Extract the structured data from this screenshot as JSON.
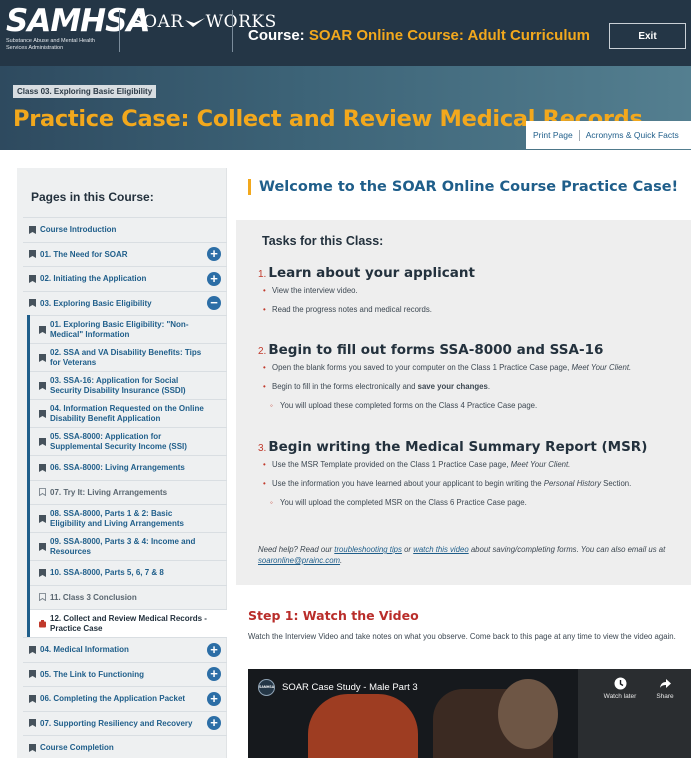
{
  "header": {
    "logo_text": "SAMHSA",
    "logo_sub": "Substance Abuse and Mental Health Services Administration",
    "soar_logo_left": "SOAR",
    "soar_logo_right": "WORKS",
    "course_prefix": "Course:",
    "course_name": "SOAR Online Course: Adult Curriculum",
    "exit_label": "Exit"
  },
  "title_band": {
    "class_tag": "Class 03. Exploring Basic Eligibility",
    "page_title": "Practice Case: Collect and Review Medical Records",
    "print_label": "Print Page",
    "acronyms_label": "Acronyms & Quick Facts"
  },
  "sidebar": {
    "title": "Pages in this Course:",
    "items": [
      {
        "label": "Course Introduction",
        "expand": false
      },
      {
        "label": "01. The Need for SOAR",
        "expand": "plus"
      },
      {
        "label": "02. Initiating the Application",
        "expand": "plus"
      },
      {
        "label": "03. Exploring Basic Eligibility",
        "expand": "minus"
      }
    ],
    "subitems": [
      {
        "label": "01. Exploring Basic Eligibility: \"Non-Medical\" Information",
        "state": "done"
      },
      {
        "label": "02. SSA and VA Disability Benefits: Tips for Veterans",
        "state": "done"
      },
      {
        "label": "03. SSA-16: Application for Social Security Disability Insurance (SSDI)",
        "state": "done"
      },
      {
        "label": "04. Information Requested on the Online Disability Benefit Application",
        "state": "done"
      },
      {
        "label": "05. SSA-8000: Application for Supplemental Security Income (SSI)",
        "state": "done"
      },
      {
        "label": "06. SSA-8000: Living Arrangements",
        "state": "done"
      },
      {
        "label": "07. Try It: Living Arrangements",
        "state": "open"
      },
      {
        "label": "08. SSA-8000, Parts 1 & 2: Basic Eligibility and Living Arrangements",
        "state": "done"
      },
      {
        "label": "09. SSA-8000, Parts 3 & 4: Income and Resources",
        "state": "done"
      },
      {
        "label": "10. SSA-8000, Parts 5, 6, 7 & 8",
        "state": "done"
      },
      {
        "label": "11. Class 3 Conclusion",
        "state": "open"
      },
      {
        "label": "12. Collect and Review Medical Records - Practice Case",
        "state": "current"
      }
    ],
    "items_after": [
      {
        "label": "04. Medical Information",
        "expand": "plus"
      },
      {
        "label": "05. The Link to Functioning",
        "expand": "plus"
      },
      {
        "label": "06. Completing the Application Packet",
        "expand": "plus"
      },
      {
        "label": "07. Supporting Resiliency and Recovery",
        "expand": "plus"
      },
      {
        "label": "Course Completion",
        "expand": false
      }
    ]
  },
  "main": {
    "welcome": "Welcome to the SOAR Online Course Practice Case!",
    "tasks_heading": "Tasks for this Class:",
    "task1": {
      "num": "1.",
      "title": "Learn about your applicant",
      "b1": "View the interview video.",
      "b2": "Read the progress notes and medical records."
    },
    "task2": {
      "num": "2.",
      "title": "Begin to fill out forms SSA-8000 and SSA-16",
      "b1_pre": "Open the blank forms you saved to your computer on the Class 1 Practice Case page, ",
      "b1_em": "Meet Your Client.",
      "b2_pre": "Begin to fill in the forms electronically and ",
      "b2_bold": "save your changes",
      "b2_post": ".",
      "b3": "You will upload these completed forms on the Class 4 Practice Case page."
    },
    "task3": {
      "num": "3.",
      "title": "Begin writing the Medical Summary Report (MSR)",
      "b1_pre": "Use the MSR Template provided on the Class 1 Practice Case page, ",
      "b1_em": "Meet Your Client.",
      "b2_pre": "Use the information you have learned about your applicant to begin writing the ",
      "b2_em": "Personal History",
      "b2_post": " Section.",
      "b3": "You will upload the completed MSR on the Class 6 Practice Case page."
    },
    "help": {
      "pre": "Need help? Read our ",
      "link1": "troubleshooting tips",
      "mid": " or ",
      "link2": "watch this video",
      "post": " about saving/completing forms. You can also email us at ",
      "email": "soaronline@prainc.com",
      "end": "."
    },
    "step1_title": "Step 1: Watch the Video",
    "step1_desc": "Watch the Interview Video and take notes on what you observe. Come back to this page at any time to view the video again.",
    "video": {
      "logo": "SAMHSA",
      "title": "SOAR Case Study - Male Part 3",
      "watch_later": "Watch later",
      "share": "Share"
    }
  },
  "colors": {
    "header_bg": "#243646",
    "accent_gold": "#f2a81d",
    "link_blue": "#1f5e8a",
    "step_red": "#b92d2a"
  }
}
